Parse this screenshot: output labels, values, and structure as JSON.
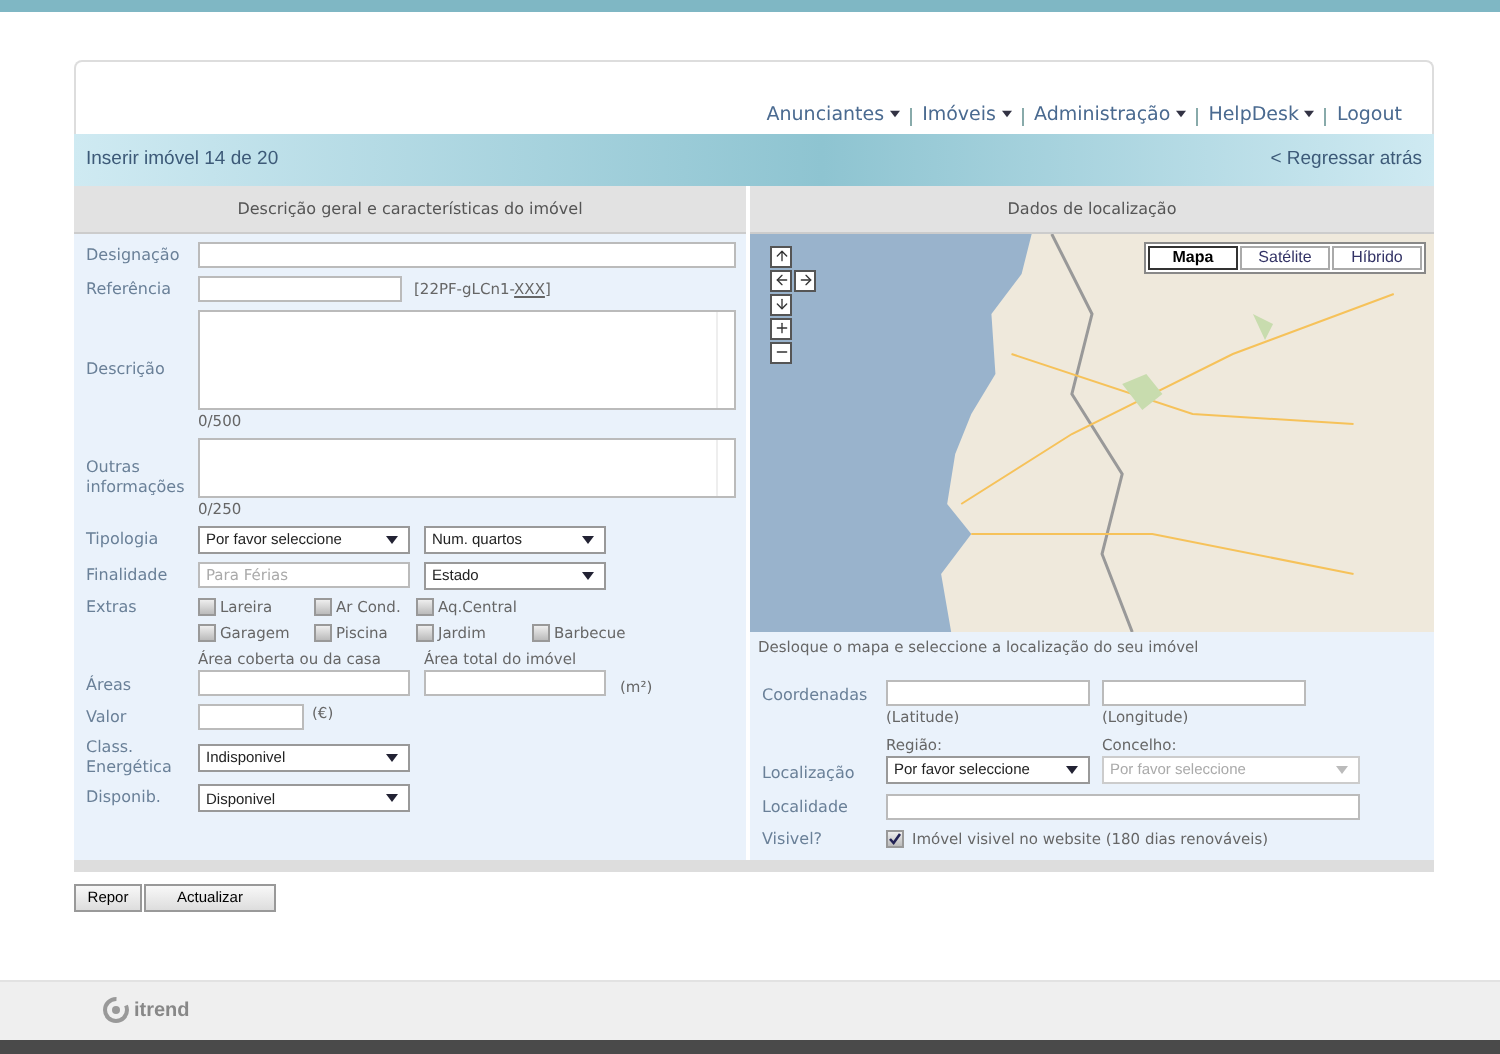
{
  "nav": [
    {
      "label": "Anunciantes",
      "dropdown": true
    },
    {
      "label": "Imóveis",
      "dropdown": true
    },
    {
      "label": "Administração",
      "dropdown": true
    },
    {
      "label": "HelpDesk",
      "dropdown": true
    },
    {
      "label": "Logout",
      "dropdown": false
    }
  ],
  "banner": {
    "title": "Inserir imóvel 14 de 20",
    "back_link": "< Regressar atrás"
  },
  "description_panel": {
    "heading": "Descrição geral e características do imóvel",
    "designacao": {
      "label": "Designação"
    },
    "referencia": {
      "label": "Referência",
      "code_prefix": "[22PF-gLCn1-",
      "code_link": "XXX",
      "code_suffix": "]"
    },
    "descricao": {
      "label": "Descrição",
      "counter": "0/500"
    },
    "outras": {
      "label": "Outras informações",
      "counter": "0/250"
    },
    "tipologia": {
      "label": "Tipologia",
      "selects": [
        "Por favor seleccione",
        "Num. quartos"
      ]
    },
    "finalidade": {
      "label": "Finalidade",
      "placeholder": "Para Férias",
      "select": "Estado"
    },
    "extras": {
      "label": "Extras",
      "rows": [
        [
          {
            "label": "Lareira",
            "checked": false
          },
          {
            "label": "Ar Cond.",
            "checked": false
          },
          {
            "label": "Aq.Central",
            "checked": false
          }
        ],
        [
          {
            "label": "Garagem",
            "checked": false
          },
          {
            "label": "Piscina",
            "checked": false
          },
          {
            "label": "Jardim",
            "checked": false
          },
          {
            "label": "Barbecue",
            "checked": false
          }
        ]
      ]
    },
    "areas": {
      "label": "Áreas",
      "captions": [
        "Área coberta ou da casa",
        "Área total do imóvel"
      ],
      "unit": "(m²)"
    },
    "valor": {
      "label": "Valor",
      "unit": "(€)"
    },
    "class_energetica": {
      "label": "Class. Energética",
      "value": "Indisponivel"
    },
    "disponib": {
      "label": "Disponib.",
      "value": "Disponivel"
    }
  },
  "location_panel": {
    "heading": "Dados de localização",
    "map_types": [
      {
        "label": "Mapa",
        "selected": true
      },
      {
        "label": "Satélite",
        "selected": false
      },
      {
        "label": "Híbrido",
        "selected": false
      }
    ],
    "hint": "Desloque o mapa e seleccione a localização do seu imóvel",
    "coordenadas": {
      "label": "Coordenadas",
      "captions": [
        "(Latitude)",
        "(Longitude)"
      ]
    },
    "localizacao": {
      "label": "Localização",
      "regiao": {
        "caption": "Região:",
        "value": "Por favor seleccione",
        "disabled": false
      },
      "concelho": {
        "caption": "Concelho:",
        "placeholder": "Por favor seleccione",
        "disabled": true
      }
    },
    "localidade": {
      "label": "Localidade"
    },
    "visivel": {
      "label": "Visivel?",
      "checkbox_label": "Imóvel visivel no website (180 dias renováveis)",
      "checked": true
    }
  },
  "buttons": [
    {
      "label": "Repor"
    },
    {
      "label": "Actualizar"
    }
  ],
  "footer": {
    "brand": "itrend"
  }
}
